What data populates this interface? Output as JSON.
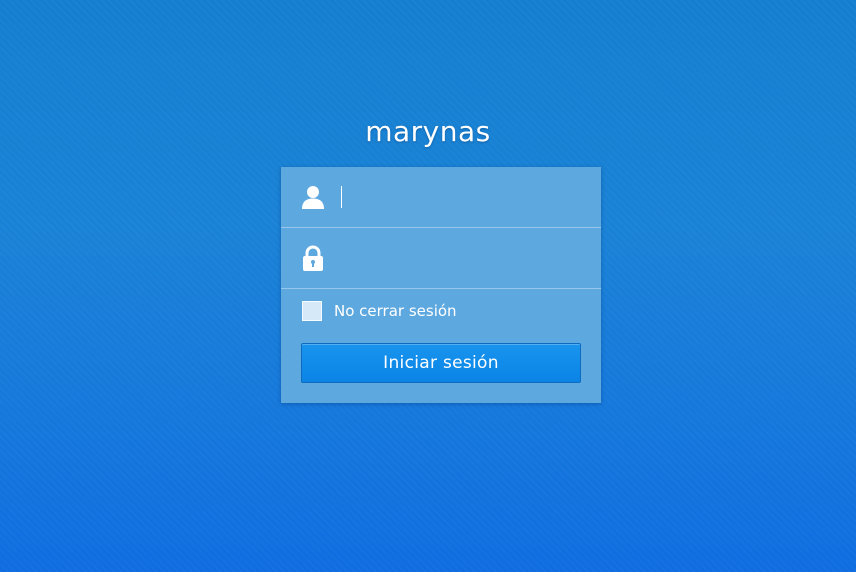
{
  "hostname": "marynas",
  "login_form": {
    "username": {
      "icon": "user-icon",
      "value": "",
      "placeholder": ""
    },
    "password": {
      "icon": "lock-icon",
      "value": "",
      "placeholder": ""
    },
    "remember_me": {
      "label": "No cerrar sesión",
      "checked": false
    },
    "submit_label": "Iniciar sesión"
  },
  "colors": {
    "background": "#1a82d6",
    "panel": "#5ea8e0",
    "button": "#0b84e6",
    "text": "#ffffff"
  }
}
